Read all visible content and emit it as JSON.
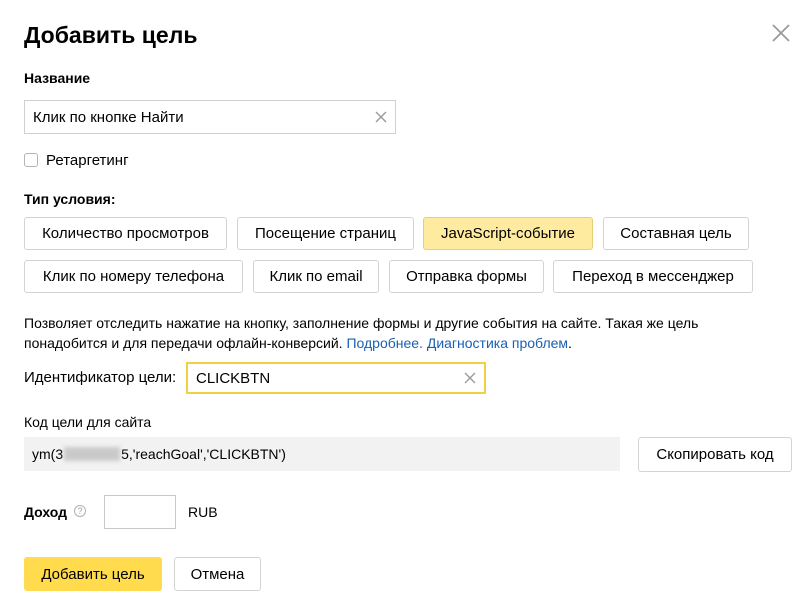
{
  "dialog": {
    "title": "Добавить цель",
    "name_label": "Название",
    "name_value": "Клик по кнопке Найти",
    "retargeting_label": "Ретаргетинг",
    "retargeting_checked": false,
    "condition_type_label": "Тип условия:",
    "condition_types": [
      {
        "label": "Количество просмотров",
        "active": false
      },
      {
        "label": "Посещение страниц",
        "active": false
      },
      {
        "label": "JavaScript-событие",
        "active": true
      },
      {
        "label": "Составная цель",
        "active": false
      },
      {
        "label": "Клик по номеру телефона",
        "active": false
      },
      {
        "label": "Клик по email",
        "active": false
      },
      {
        "label": "Отправка формы",
        "active": false
      },
      {
        "label": "Переход в мессенджер",
        "active": false
      }
    ],
    "description": "Позволяет отследить нажатие на кнопку, заполнение формы и другие события на сайте. Такая же цель понадобится и для передачи офлайн-конверсий.",
    "link_more": "Подробнее.",
    "link_diagnostics": "Диагностика проблем",
    "period": ".",
    "goal_id_label": "Идентификатор цели:",
    "goal_id_value": "CLICKBTN",
    "site_code_label": "Код цели для сайта",
    "code_prefix": "ym(3",
    "code_suffix": "5,'reachGoal','CLICKBTN')",
    "copy_code_button": "Скопировать код",
    "income_label": "Доход",
    "income_help": "?",
    "income_value": "",
    "currency": "RUB",
    "submit_button": "Добавить цель",
    "cancel_button": "Отмена"
  },
  "colors": {
    "accent_yellow": "#ffdb4d",
    "active_tab": "#ffeba0",
    "link": "#1a5fb4",
    "focus_border": "#f0cf47"
  }
}
